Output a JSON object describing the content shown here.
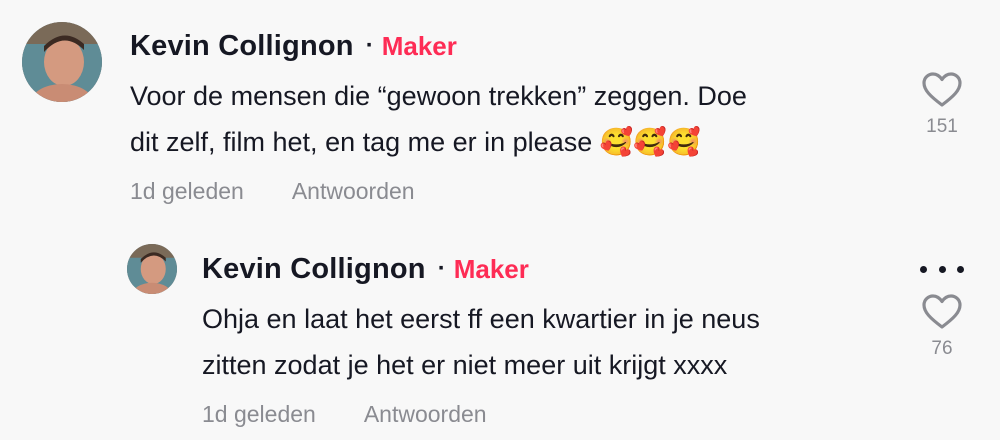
{
  "comments": [
    {
      "author": "Kevin Collignon",
      "separator": "·",
      "badge": "Maker",
      "text_line1": "Voor de mensen die “gewoon trekken” zeggen. Doe",
      "text_line2": "dit zelf, film het, en tag me er in please 🥰🥰🥰",
      "time": "1d geleden",
      "reply_label": "Antwoorden",
      "likes": "151",
      "like_icon": "heart-outline-icon"
    },
    {
      "author": "Kevin Collignon",
      "separator": "·",
      "badge": "Maker",
      "text_line1": "Ohja en laat het eerst ff een kwartier in je neus",
      "text_line2": "zitten zodat je het er niet meer uit krijgt xxxx",
      "time": "1d geleden",
      "reply_label": "Antwoorden",
      "likes": "76",
      "like_icon": "heart-outline-icon",
      "more_icon": "more-dots-icon"
    }
  ],
  "colors": {
    "badge": "#fe2c55",
    "muted": "#8a8b91",
    "text": "#161823",
    "background": "#f8f8f8"
  }
}
